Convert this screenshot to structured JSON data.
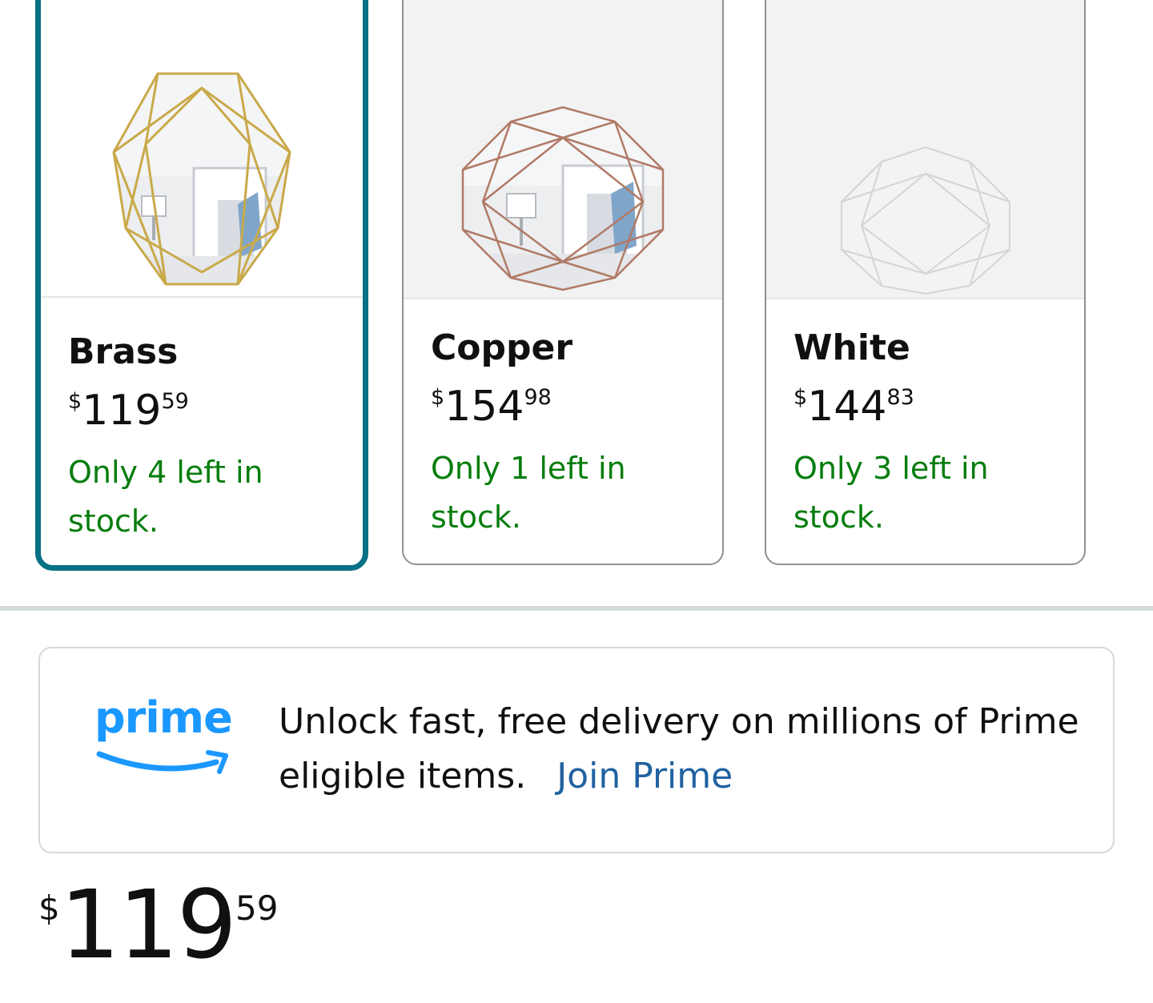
{
  "variants": [
    {
      "name": "Brass",
      "price_symbol": "$",
      "price_whole": "119",
      "price_fraction": "59",
      "stock_text": "Only 4 left in stock.",
      "selected": true,
      "frame_color": "#c9a94a"
    },
    {
      "name": "Copper",
      "price_symbol": "$",
      "price_whole": "154",
      "price_fraction": "98",
      "stock_text": "Only 1 left in stock.",
      "selected": false,
      "frame_color": "#b07a66"
    },
    {
      "name": "White",
      "price_symbol": "$",
      "price_whole": "144",
      "price_fraction": "83",
      "stock_text": "Only 3 left in stock.",
      "selected": false,
      "frame_color": "#d9d9dc"
    }
  ],
  "prime_banner": {
    "logo_text": "prime",
    "message": "Unlock fast, free delivery on millions of Prime eligible items.",
    "link_label": "Join Prime",
    "logo_color": "#1a98ff",
    "link_color": "#2162a1"
  },
  "main_price": {
    "symbol": "$",
    "whole": "119",
    "fraction": "59"
  },
  "colors": {
    "selected_border": "#077185",
    "stock_green": "#067d0d",
    "text": "#0f1111"
  }
}
